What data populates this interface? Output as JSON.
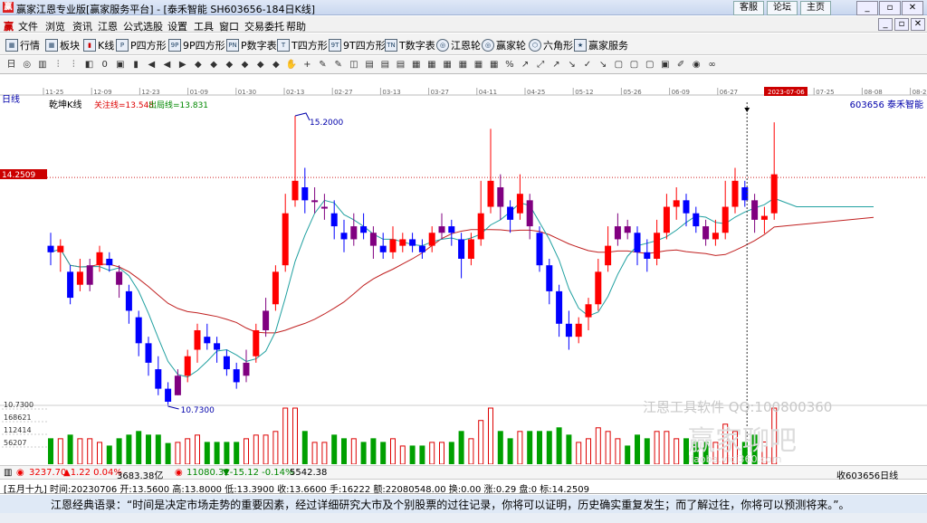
{
  "titlebar": {
    "title": "赢家江恩专业版[赢家服务平台] - [泰禾智能  SH603656-184日K线]",
    "links": [
      "客服",
      "论坛",
      "主页"
    ],
    "logo_text": "赢"
  },
  "menu": [
    "文件",
    "浏览",
    "资讯",
    "江恩",
    "公式选股",
    "设置",
    "工具",
    "窗口",
    "交易委托",
    "帮助"
  ],
  "toolbar1": [
    {
      "icon": "grid-icon",
      "label": "行情"
    },
    {
      "icon": "grid-icon",
      "label": "板块"
    },
    {
      "icon": "candle-icon",
      "label": "K线"
    },
    {
      "icon": "p-icon",
      "label": "P四方形"
    },
    {
      "icon": "9p-icon",
      "label": "9P四方形"
    },
    {
      "icon": "pn-icon",
      "label": "P数字表"
    },
    {
      "icon": "t-icon",
      "label": "T四方形"
    },
    {
      "icon": "9t-icon",
      "label": "9T四方形"
    },
    {
      "icon": "tn-icon",
      "label": "T数字表"
    },
    {
      "icon": "wheel-icon",
      "label": "江恩轮"
    },
    {
      "icon": "wheel-icon",
      "label": "赢家轮"
    },
    {
      "icon": "hexagon-icon",
      "label": "六角形"
    },
    {
      "icon": "service-icon",
      "label": "赢家服务"
    }
  ],
  "toolbar2_glyphs": [
    "日",
    "◎",
    "▥",
    "⫶",
    "⫶",
    "◧",
    "0",
    "▣",
    "▮",
    "◀",
    "◀",
    "▶",
    "◆",
    "◆",
    "◆",
    "◆",
    "◆",
    "◆",
    "✋",
    "+",
    "✎",
    "✎",
    "◫",
    "▤",
    "▤",
    "▤",
    "▦",
    "▦",
    "▦",
    "▦",
    "▦",
    "▦",
    "%",
    "↗",
    "⤢",
    "↗",
    "↘",
    "✓",
    "↘",
    "▢",
    "▢",
    "▢",
    "▣",
    "✐",
    "◉",
    "∞"
  ],
  "chart": {
    "period_label": "日线",
    "indicator_label": "乾坤K线",
    "watch_line": "关注线=13.548",
    "exit_line": "出局线=13.831",
    "stock": "603656 泰禾智能",
    "price_marker": "14.2509",
    "selected_date": "2023-07-06",
    "high_label": "15.2000",
    "low_label": "10.7300",
    "vol_axis": [
      "10.7300",
      "168621",
      "112414",
      "56207"
    ],
    "dates": [
      "11-25",
      "12-09",
      "12-23",
      "01-09",
      "01-30",
      "02-13",
      "02-27",
      "03-13",
      "03-27",
      "04-11",
      "04-25",
      "05-12",
      "05-26",
      "06-09",
      "06-27",
      "2023-07-06",
      "07-25",
      "08-08",
      "08-22"
    ],
    "watermark": "江恩工具软件  QQ:100800360",
    "watermark2": "赢家聊吧",
    "watermark3": "liaoba.vicj360.com"
  },
  "bottom1": {
    "sh": "3237.70",
    "sh_change": "▲1.22 0.04%",
    "sh_amount": "3683.38亿",
    "sz": "11080.32",
    "sz_change": "▼-15.12 -0.14%",
    "sz_amount": "5542.38",
    "right": "收603656日线"
  },
  "bottom2": "[五月十九] 时间:20230706 开:13.5600 高:13.8000 低:13.3900 收:13.6600 手:16222 额:22080548.00 换:0.00 涨:0.29 盘:0 标:14.2509",
  "quote": "江恩经典语录：“时间是决定市场走势的重要因素，经过详细研究大市及个别股票的过往记录，你将可以证明，历史确实重复发生；而了解过往，你将可以预测将来。”。",
  "colors": {
    "up": "#ff0000",
    "down": "#0000ff",
    "neutral": "#800080",
    "ma": "#c02020",
    "signal": "#20a0a0",
    "marker": "#cc0000"
  },
  "chart_data": {
    "type": "candlestick",
    "title": "泰禾智能 603656 日线",
    "ylim": [
      10.73,
      15.2
    ],
    "candles": [
      [
        13.2,
        13.1,
        13.4,
        12.9
      ],
      [
        13.1,
        13.2,
        13.3,
        12.8
      ],
      [
        12.8,
        12.4,
        12.9,
        12.3
      ],
      [
        12.6,
        12.8,
        13.0,
        12.5
      ],
      [
        12.6,
        12.9,
        13.0,
        12.5
      ],
      [
        12.9,
        13.1,
        13.2,
        12.8
      ],
      [
        13.0,
        12.9,
        13.1,
        12.8
      ],
      [
        12.8,
        12.6,
        12.9,
        12.4
      ],
      [
        12.5,
        12.2,
        12.6,
        12.0
      ],
      [
        12.1,
        11.7,
        12.2,
        11.5
      ],
      [
        11.7,
        11.4,
        11.8,
        11.2
      ],
      [
        11.3,
        11.0,
        11.5,
        10.9
      ],
      [
        11.0,
        10.8,
        11.1,
        10.73
      ],
      [
        10.9,
        11.2,
        11.3,
        10.9
      ],
      [
        11.2,
        11.5,
        11.6,
        11.1
      ],
      [
        11.6,
        11.9,
        12.0,
        11.4
      ],
      [
        11.8,
        11.7,
        12.0,
        11.6
      ],
      [
        11.7,
        11.6,
        11.8,
        11.4
      ],
      [
        11.5,
        11.3,
        11.6,
        11.2
      ],
      [
        11.3,
        11.1,
        11.4,
        11.0
      ],
      [
        11.2,
        11.4,
        11.6,
        11.1
      ],
      [
        11.5,
        11.9,
        12.0,
        11.4
      ],
      [
        11.9,
        12.2,
        12.4,
        11.8
      ],
      [
        12.3,
        12.8,
        12.9,
        12.2
      ],
      [
        12.9,
        13.7,
        14.0,
        12.8
      ],
      [
        13.9,
        14.2,
        15.2,
        13.8
      ],
      [
        14.1,
        13.9,
        14.4,
        13.7
      ],
      [
        13.9,
        13.9,
        14.1,
        13.7
      ],
      [
        13.8,
        13.8,
        14.0,
        13.6
      ],
      [
        13.7,
        13.5,
        13.9,
        13.3
      ],
      [
        13.4,
        13.3,
        13.6,
        13.1
      ],
      [
        13.3,
        13.5,
        13.7,
        13.2
      ],
      [
        13.5,
        13.4,
        13.7,
        13.3
      ],
      [
        13.4,
        13.2,
        13.5,
        13.0
      ],
      [
        13.2,
        13.1,
        13.4,
        13.0
      ],
      [
        13.1,
        13.3,
        13.5,
        13.0
      ],
      [
        13.2,
        13.3,
        13.4,
        13.1
      ],
      [
        13.3,
        13.2,
        13.4,
        13.1
      ],
      [
        13.2,
        13.1,
        13.3,
        13.0
      ],
      [
        13.2,
        13.4,
        13.5,
        13.1
      ],
      [
        13.4,
        13.5,
        13.7,
        13.3
      ],
      [
        13.5,
        13.4,
        13.6,
        13.2
      ],
      [
        13.3,
        13.0,
        13.4,
        12.7
      ],
      [
        13.0,
        13.3,
        13.4,
        12.9
      ],
      [
        13.3,
        13.7,
        14.2,
        13.2
      ],
      [
        13.8,
        14.2,
        15.0,
        13.7
      ],
      [
        14.1,
        13.8,
        14.3,
        13.6
      ],
      [
        13.8,
        13.6,
        13.9,
        13.4
      ],
      [
        13.7,
        14.0,
        14.3,
        13.6
      ],
      [
        13.9,
        13.5,
        14.0,
        13.3
      ],
      [
        13.4,
        12.9,
        13.5,
        12.8
      ],
      [
        12.9,
        12.5,
        13.0,
        12.3
      ],
      [
        12.5,
        12.0,
        12.6,
        11.8
      ],
      [
        12.0,
        11.8,
        12.2,
        11.6
      ],
      [
        11.8,
        12.0,
        12.1,
        11.7
      ],
      [
        12.1,
        12.3,
        12.4,
        11.9
      ],
      [
        12.3,
        12.8,
        13.0,
        12.2
      ],
      [
        12.9,
        13.2,
        13.5,
        12.8
      ],
      [
        13.3,
        13.5,
        13.7,
        13.2
      ],
      [
        13.5,
        13.4,
        13.6,
        13.3
      ],
      [
        13.4,
        13.1,
        13.5,
        12.9
      ],
      [
        13.1,
        13.0,
        13.3,
        12.8
      ],
      [
        13.0,
        13.4,
        13.6,
        12.9
      ],
      [
        13.4,
        13.8,
        14.0,
        13.3
      ],
      [
        13.8,
        13.9,
        14.1,
        13.6
      ],
      [
        13.9,
        13.7,
        14.0,
        13.5
      ],
      [
        13.7,
        13.5,
        13.8,
        13.4
      ],
      [
        13.5,
        13.3,
        13.6,
        13.2
      ],
      [
        13.3,
        13.4,
        13.6,
        13.2
      ],
      [
        13.4,
        13.8,
        14.2,
        13.3
      ],
      [
        13.8,
        14.2,
        14.4,
        13.7
      ],
      [
        14.1,
        13.9,
        14.2,
        13.8
      ],
      [
        13.9,
        13.6,
        14.0,
        13.4
      ],
      [
        13.6,
        13.66,
        13.8,
        13.39
      ],
      [
        13.7,
        14.3,
        15.1,
        13.6
      ]
    ]
  }
}
